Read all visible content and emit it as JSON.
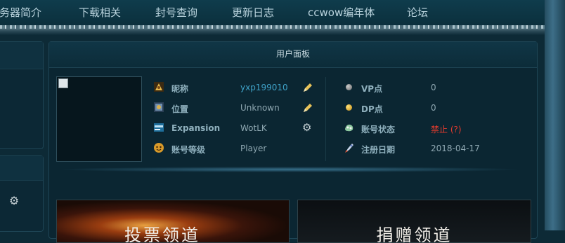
{
  "nav": {
    "items": [
      "服务器简介",
      "下载相关",
      "封号查询",
      "更新日志",
      "ccwow编年体",
      "论坛"
    ]
  },
  "panel": {
    "title": "用户面板",
    "left_rows": [
      {
        "icon": "nickname-icon",
        "label": "昵称",
        "value": "yxp199010",
        "action": "pencil-icon"
      },
      {
        "icon": "location-icon",
        "label": "位置",
        "value": "Unknown",
        "action": "pencil-icon"
      },
      {
        "icon": "expansion-icon",
        "label": "Expansion",
        "value": "WotLK",
        "action": "gear-icon"
      },
      {
        "icon": "account-level-icon",
        "label": "账号等级",
        "value": "Player"
      }
    ],
    "right_rows": [
      {
        "icon": "vp-coin-icon",
        "label": "VP点",
        "value": "0"
      },
      {
        "icon": "dp-coin-icon",
        "label": "DP点",
        "value": "0"
      },
      {
        "icon": "account-status-icon",
        "label": "账号状态",
        "value": "禁止 (?)"
      },
      {
        "icon": "register-date-icon",
        "label": "注册日期",
        "value": "2018-04-17"
      }
    ]
  },
  "banners": [
    "投票领道",
    "捐赠领道"
  ],
  "colors": {
    "link": "#3fa3c9",
    "banned": "#e23b2e",
    "label": "#8fb0bd"
  }
}
